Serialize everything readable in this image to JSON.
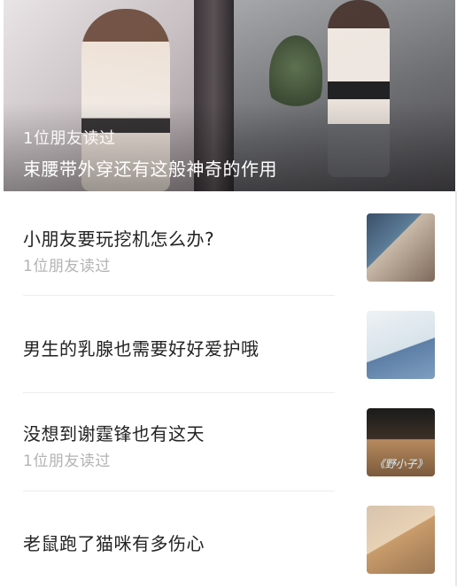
{
  "hero": {
    "readers": "1位朋友读过",
    "title": "束腰带外穿还有这般神奇的作用"
  },
  "items": [
    {
      "title": "小朋友要玩挖机怎么办?",
      "readers": "1位朋友读过"
    },
    {
      "title": "男生的乳腺也需要好好爱护哦",
      "readers": ""
    },
    {
      "title": "没想到谢霆锋也有这天",
      "readers": "1位朋友读过",
      "thumb_caption": "《野小子》"
    },
    {
      "title": "老鼠跑了猫咪有多伤心",
      "readers": ""
    }
  ]
}
